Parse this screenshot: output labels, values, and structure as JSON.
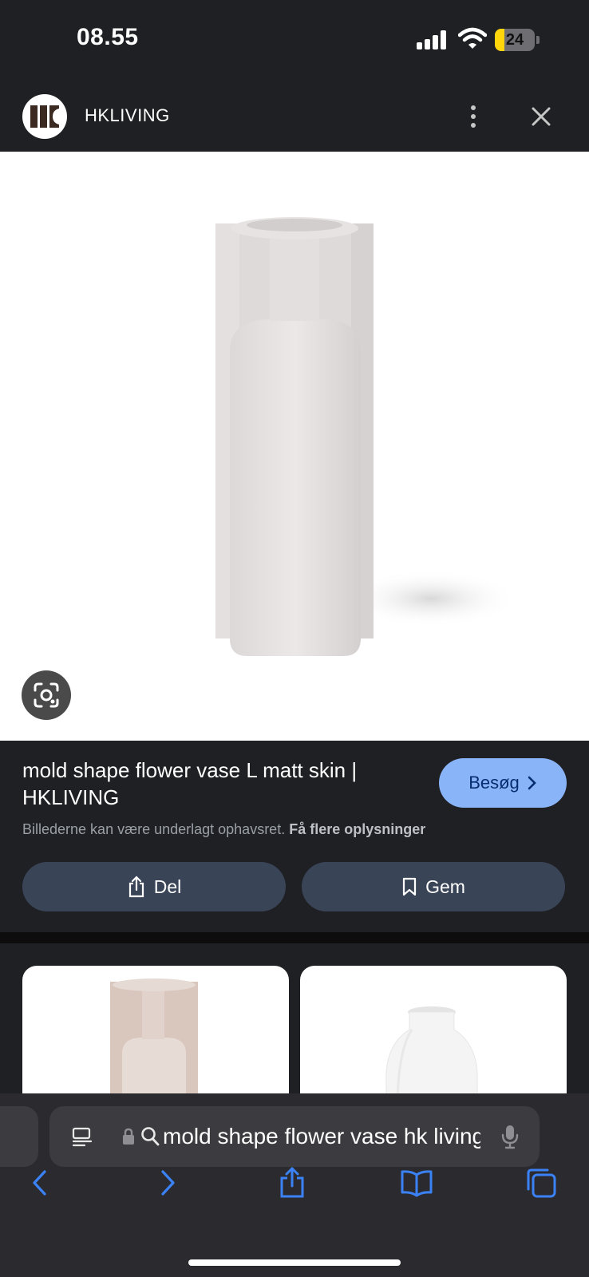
{
  "status_bar": {
    "time": "08.55",
    "battery_level": "24",
    "battery_percent": 24
  },
  "header": {
    "site_name": "HKLIVING",
    "logo_icon": "hkliving-logo"
  },
  "image": {
    "description_icon": "vase-image",
    "lens_icon": "google-lens-icon"
  },
  "result": {
    "title": "mold shape flower vase L matt skin | HKLIVING",
    "visit_label": "Besøg",
    "copyright_text": "Billederne kan være underlagt ophavsret.",
    "copyright_link": "Få flere oplysninger",
    "share_label": "Del",
    "save_label": "Gem"
  },
  "browser": {
    "address_text": "mold shape flower vase hk living",
    "nav": [
      "back-icon",
      "forward-icon",
      "share-icon",
      "bookmarks-icon",
      "tabs-icon"
    ]
  },
  "colors": {
    "accent": "#8ab4f8",
    "action_button": "#394457",
    "background": "#1f2024"
  }
}
